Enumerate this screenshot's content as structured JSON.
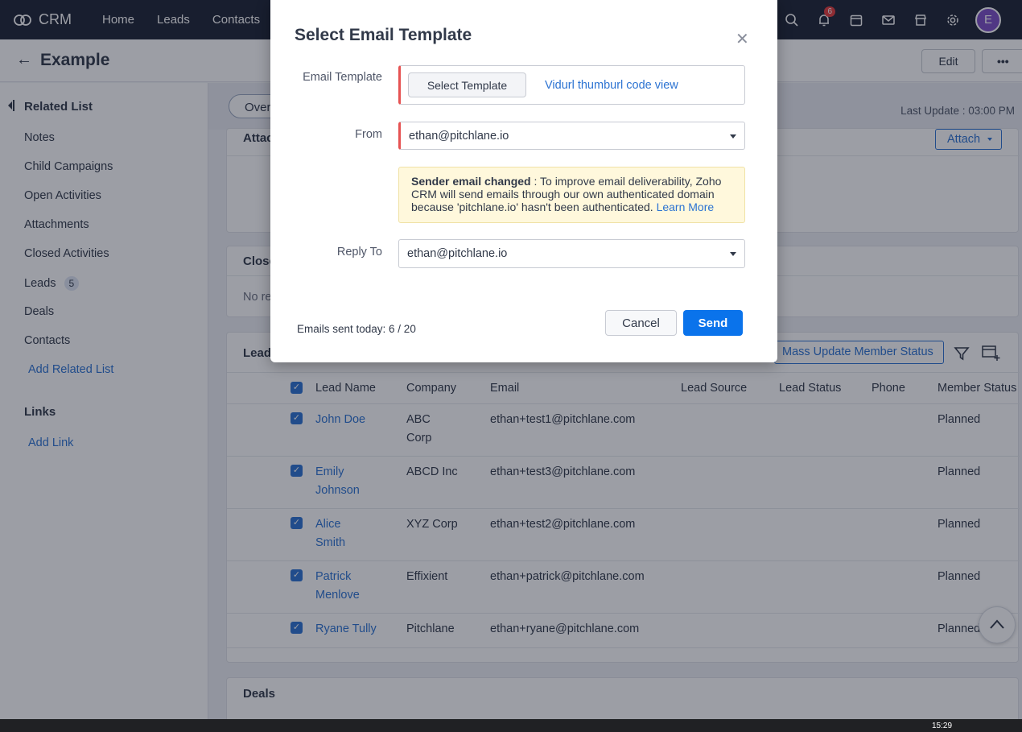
{
  "topbar": {
    "brand": "CRM",
    "nav": [
      "Home",
      "Leads",
      "Contacts"
    ],
    "notification_count": "6",
    "avatar_initial": "E"
  },
  "subheader": {
    "title": "Example",
    "edit_label": "Edit",
    "more_label": "•••"
  },
  "sidebar": {
    "related_list_title": "Related List",
    "items": [
      "Notes",
      "Child Campaigns",
      "Open Activities",
      "Attachments",
      "Closed Activities",
      "Leads",
      "Deals",
      "Contacts"
    ],
    "leads_count": "5",
    "add_related_list": "Add Related List",
    "links_title": "Links",
    "add_link": "Add Link"
  },
  "main": {
    "overview_tab": "Over",
    "last_update": "Last Update : 03:00 PM",
    "attachments_title": "Attac",
    "attach_label": "Attach",
    "closed_title": "Close",
    "closed_empty": "No re",
    "leads_title": "Lead",
    "mass_update_label": "Mass Update Member Status",
    "deals_title": "Deals"
  },
  "leads_table": {
    "headers": [
      "Lead Name",
      "Company",
      "Email",
      "Lead Source",
      "Lead Status",
      "Phone",
      "Member Status"
    ],
    "rows": [
      {
        "name": [
          "John Doe"
        ],
        "company": [
          "ABC",
          "Corp"
        ],
        "email": "ethan+test1@pitchlane.com",
        "status": "Planned"
      },
      {
        "name": [
          "Emily",
          "Johnson"
        ],
        "company": [
          "ABCD Inc"
        ],
        "email": "ethan+test3@pitchlane.com",
        "status": "Planned"
      },
      {
        "name": [
          "Alice",
          "Smith"
        ],
        "company": [
          "XYZ Corp"
        ],
        "email": "ethan+test2@pitchlane.com",
        "status": "Planned"
      },
      {
        "name": [
          "Patrick",
          "Menlove"
        ],
        "company": [
          "Effixient"
        ],
        "email": "ethan+patrick@pitchlane.com",
        "status": "Planned"
      },
      {
        "name": [
          "Ryane Tully"
        ],
        "company": [
          "Pitchlane"
        ],
        "email": "ethan+ryane@pitchlane.com",
        "status": "Planned"
      }
    ]
  },
  "modal": {
    "title": "Select Email Template",
    "template_label": "Email Template",
    "select_template_button": "Select Template",
    "template_link": "Vidurl thumburl code view",
    "from_label": "From",
    "from_value": "ethan@pitchlane.io",
    "notice_bold": "Sender email changed",
    "notice_text": " : To improve email deliverability, Zoho CRM will send emails through our own authenticated domain because 'pitchlane.io' hasn't been authenticated. ",
    "notice_link": "Learn More",
    "reply_to_label": "Reply To",
    "reply_to_value": "ethan@pitchlane.io",
    "emails_sent": "Emails sent today:  6 / 20",
    "cancel_label": "Cancel",
    "send_label": "Send"
  },
  "taskbar": {
    "clock": "15:29"
  }
}
